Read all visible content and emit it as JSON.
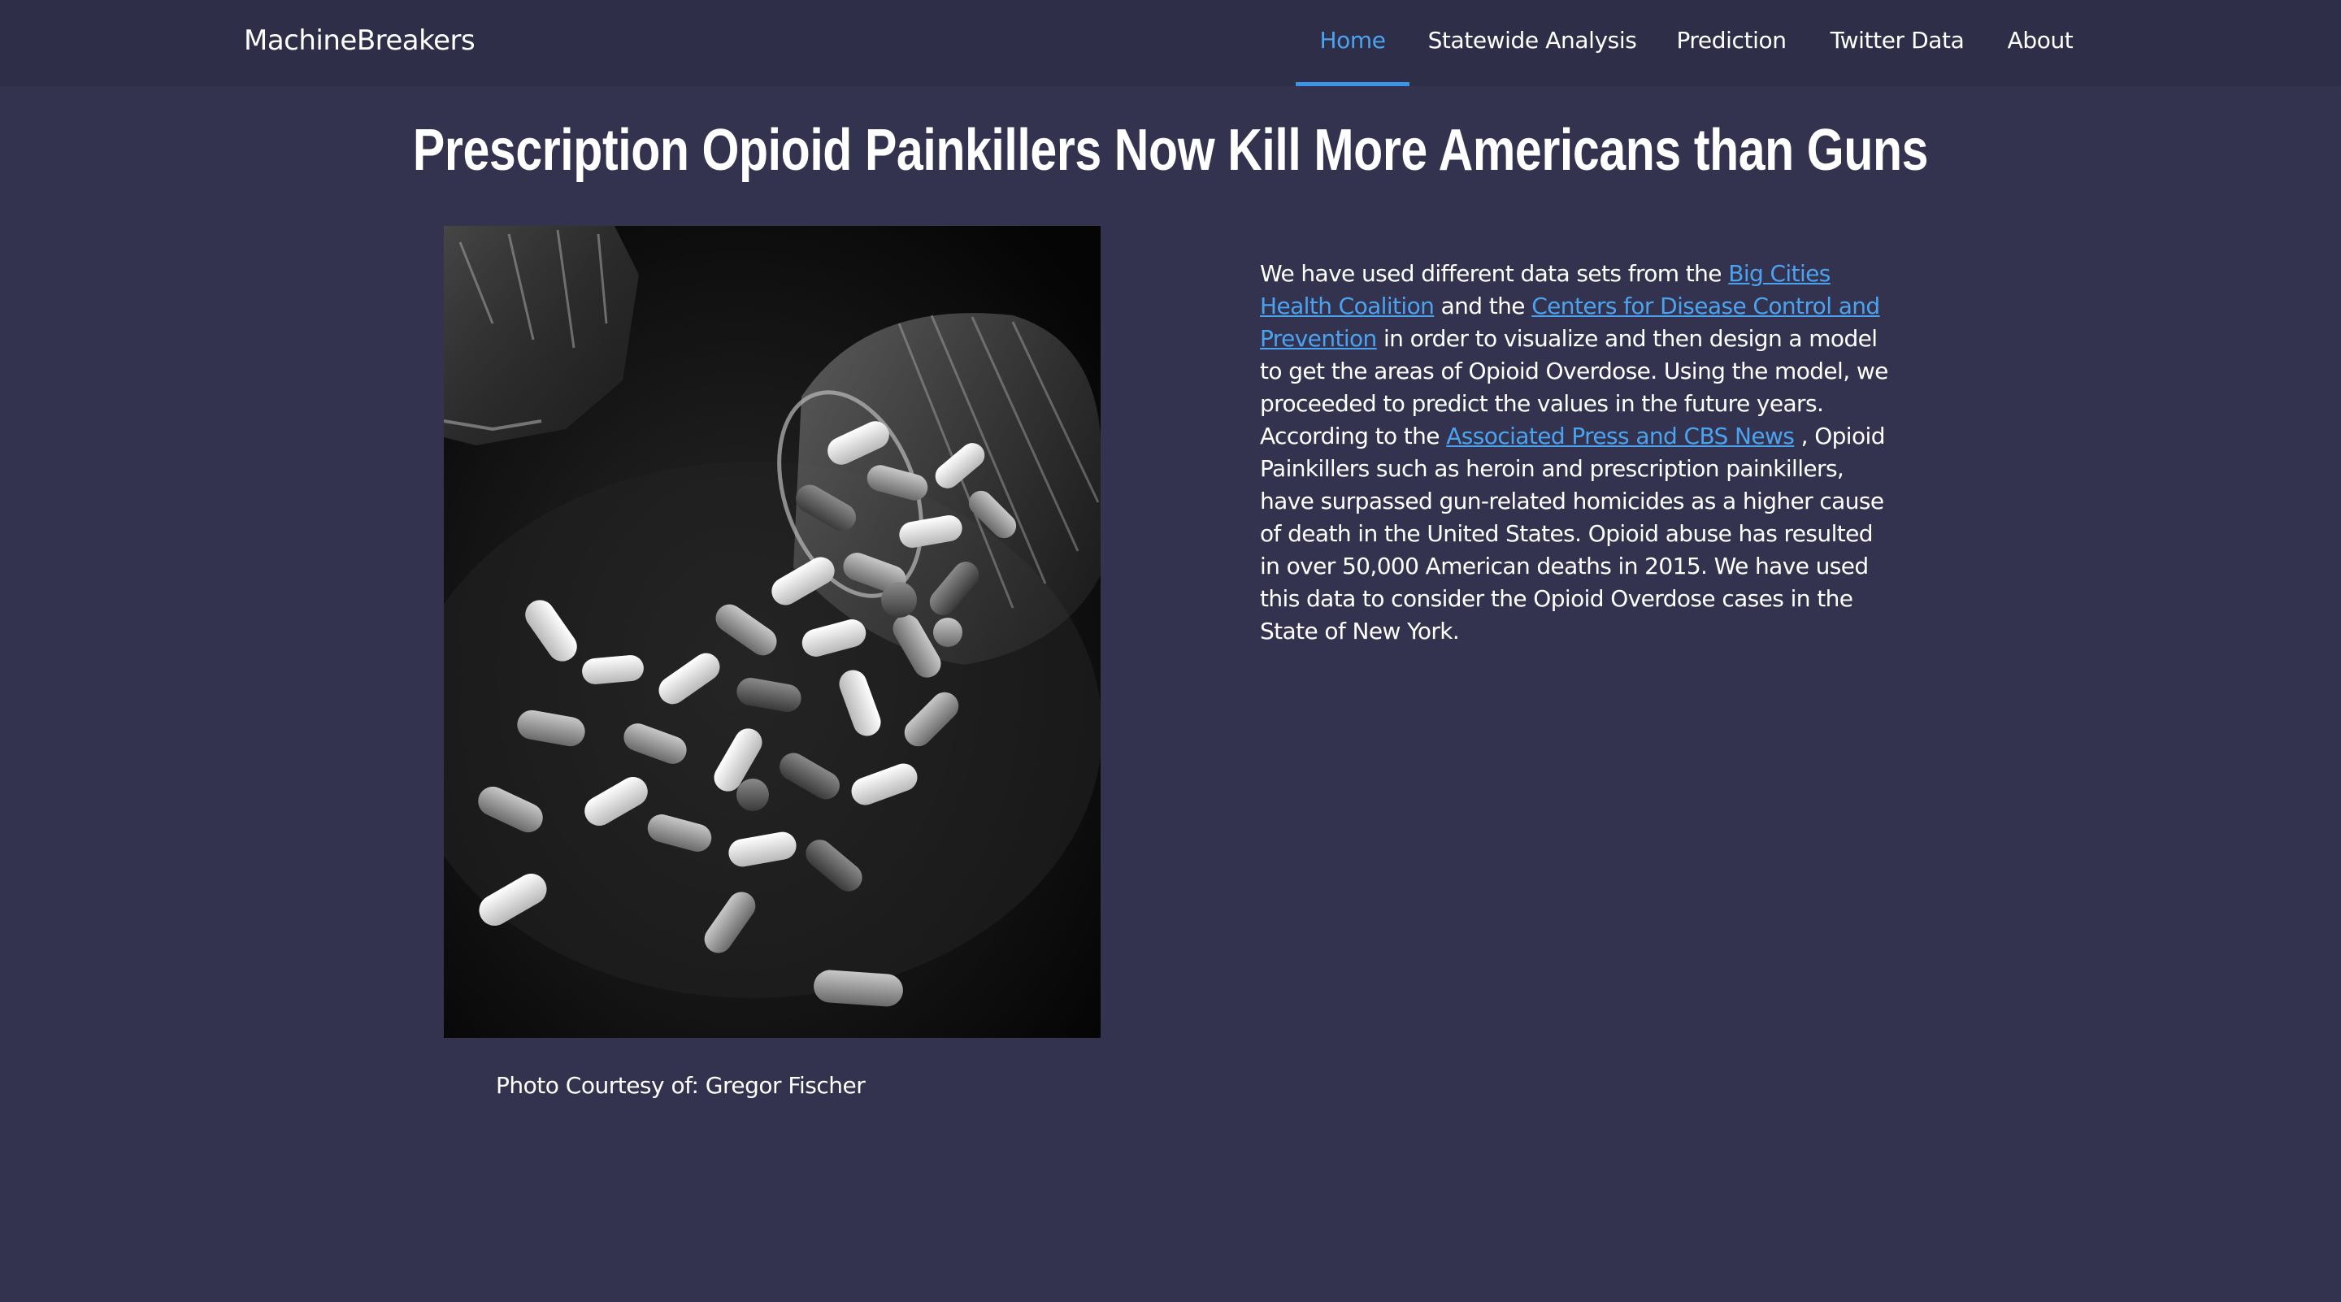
{
  "nav": {
    "brand": "MachineBreakers",
    "items": [
      {
        "label": "Home",
        "active": true
      },
      {
        "label": "Statewide Analysis",
        "active": false
      },
      {
        "label": "Prediction",
        "active": false
      },
      {
        "label": "Twitter Data",
        "active": false
      },
      {
        "label": "About",
        "active": false
      }
    ]
  },
  "main": {
    "headline": "Prescription Opioid Painkillers Now Kill More Americans than Guns",
    "photo_caption": "Photo Courtesy of: Gregor Fischer",
    "intro": {
      "part1": "We have used different data sets from the ",
      "link1": "Big Cities Health Coalition",
      "part2": " and the ",
      "link2": "Centers for Disease Control and Prevention",
      "part3": " in order to visualize and then design a model to get the areas of Opioid Overdose. Using the model, we proceeded to predict the values in the future years. According to the ",
      "link3": "Associated Press and CBS News",
      "part4": " , Opioid Painkillers such as heroin and prescription painkillers, have surpassed gun-related homicides as a higher cause of death in the United States. Opioid abuse has resulted in over 50,000 American deaths in 2015. We have used this data to consider the Opioid Overdose cases in the State of New York."
    }
  },
  "colors": {
    "page_background": "#33334f",
    "navbar_background": "#2e2e48",
    "accent": "#4ba3f0",
    "text": "#ffffff"
  }
}
